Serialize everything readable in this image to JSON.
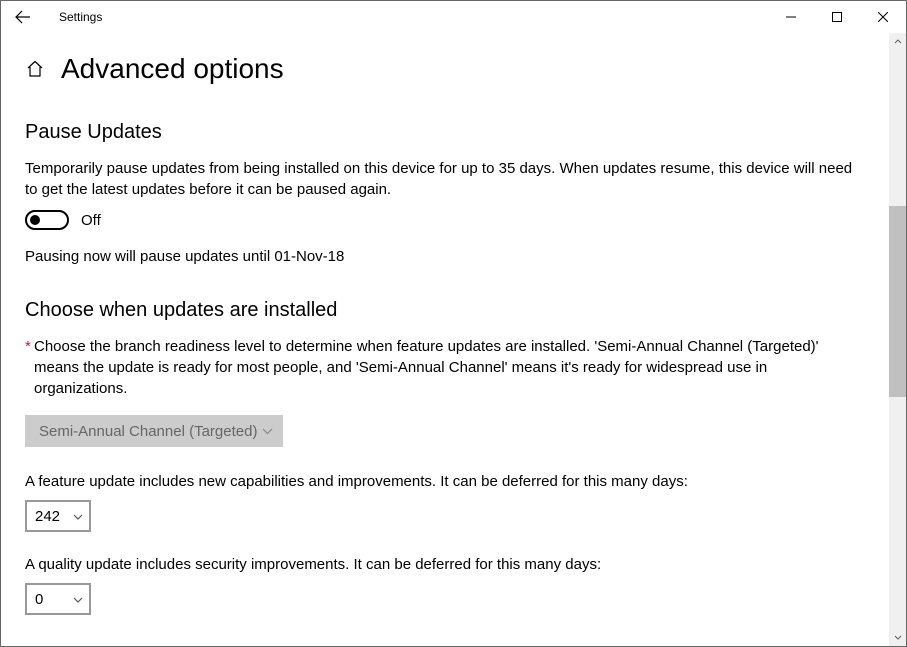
{
  "window": {
    "title": "Settings"
  },
  "header": {
    "page_title": "Advanced options"
  },
  "pause": {
    "section_title": "Pause Updates",
    "description": "Temporarily pause updates from being installed on this device for up to 35 days. When updates resume, this device will need to get the latest updates before it can be paused again.",
    "toggle_state": "Off",
    "pause_until": "Pausing now will pause updates until 01-Nov-18"
  },
  "branch": {
    "section_title": "Choose when updates are installed",
    "description": "Choose the branch readiness level to determine when feature updates are installed. 'Semi-Annual Channel (Targeted)' means the update is ready for most people, and 'Semi-Annual Channel' means it's ready for widespread use in organizations.",
    "selected": "Semi-Annual Channel (Targeted)"
  },
  "defer_feature": {
    "description": "A feature update includes new capabilities and improvements. It can be deferred for this many days:",
    "value": "242"
  },
  "defer_quality": {
    "description": "A quality update includes security improvements. It can be deferred for this many days:",
    "value": "0"
  }
}
